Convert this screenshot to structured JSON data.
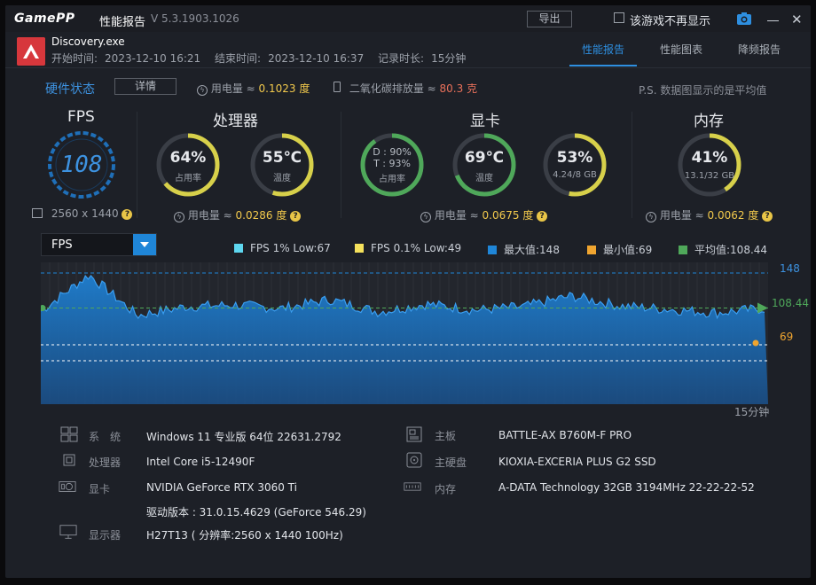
{
  "titlebar": {
    "logo": "GamePP",
    "title": "性能报告",
    "version": "V 5.3.1903.1026",
    "export_label": "导出",
    "dont_show_label": "该游戏不再显示"
  },
  "session": {
    "app_name": "Discovery.exe",
    "start_label": "开始时间:",
    "start_time": "2023-12-10 16:21",
    "end_label": "结束时间:",
    "end_time": "2023-12-10 16:37",
    "duration_label": "记录时长:",
    "duration": "15分钟"
  },
  "tabs": [
    {
      "label": "性能报告",
      "active": true
    },
    {
      "label": "性能图表",
      "active": false
    },
    {
      "label": "降频报告",
      "active": false
    }
  ],
  "summary": {
    "hw_status_label": "硬件状态",
    "detail_label": "详情",
    "power_label": "用电量 ≈",
    "power_value": "0.1023 度",
    "co2_label": "二氧化碳排放量 ≈",
    "co2_value": "80.3 克",
    "note": "P.S. 数据图显示的是平均值"
  },
  "fps": {
    "title": "FPS",
    "value": "108",
    "resolution": "2560 x 1440"
  },
  "cpu": {
    "title": "处理器",
    "usage_value": "64%",
    "usage_label": "占用率",
    "usage_fraction": 0.64,
    "temp_value": "55℃",
    "temp_label": "温度",
    "temp_fraction": 0.55,
    "power_label": "用电量 ≈",
    "power_value": "0.0286 度"
  },
  "gpu": {
    "title": "显卡",
    "d_line": "D : 90%",
    "t_line": "T : 93%",
    "usage_label": "占用率",
    "usage_fraction": 0.9,
    "temp_value": "69℃",
    "temp_label": "温度",
    "temp_fraction": 0.69,
    "vram_value": "53%",
    "vram_label": "4.24/8 GB",
    "vram_fraction": 0.53,
    "power_label": "用电量 ≈",
    "power_value": "0.0675 度"
  },
  "memory": {
    "title": "内存",
    "usage_value": "41%",
    "usage_label": "13.1/32 GB",
    "usage_fraction": 0.41,
    "power_label": "用电量 ≈",
    "power_value": "0.0062 度"
  },
  "chart_controls": {
    "selected_metric": "FPS"
  },
  "colors": {
    "accent": "#2e8fe0",
    "gauge_yellow": "#d7d04a",
    "gauge_green": "#4fa85a",
    "low1": "#5ed7f0",
    "low01": "#f5e15c",
    "max": "#1f86d8",
    "min": "#f0a530",
    "avg": "#4fa85a"
  },
  "chart_data": {
    "type": "area",
    "title": "",
    "xlabel": "15分钟",
    "ylabel": "",
    "legend": [
      {
        "name": "FPS 1% Low:67",
        "color": "#5ed7f0"
      },
      {
        "name": "FPS 0.1% Low:49",
        "color": "#f5e15c"
      },
      {
        "name": "最大值:148",
        "color": "#1f86d8"
      },
      {
        "name": "最小值:69",
        "color": "#f0a530"
      },
      {
        "name": "平均值:108.44",
        "color": "#4fa85a"
      }
    ],
    "markers": {
      "max": "148",
      "avg": "108.44",
      "min": "69"
    },
    "reference_lines": {
      "max": 148,
      "avg": 108.44,
      "min": 69,
      "low1": 67,
      "low01": 49
    },
    "ylim": [
      0,
      148
    ],
    "x": [
      0,
      1,
      2,
      3,
      4,
      5,
      6,
      7,
      8,
      9,
      10,
      11,
      12,
      13,
      14,
      15
    ],
    "series": [
      {
        "values": [
          105,
          146,
          100,
          110,
          112,
          108,
          118,
          104,
          113,
          106,
          110,
          122,
          111,
          107,
          103,
          108
        ]
      }
    ]
  },
  "specs": {
    "os_label": "系　统",
    "os_value": "Windows 11 专业版 64位 22631.2792",
    "cpu_label": "处理器",
    "cpu_value": "Intel Core i5-12490F",
    "gpu_label": "显卡",
    "gpu_value": "NVIDIA GeForce RTX 3060 Ti",
    "driver_value": "驱动版本 : 31.0.15.4629 (GeForce 546.29)",
    "display_label": "显示器",
    "display_value": "H27T13 ( 分辨率:2560 x 1440 100Hz)",
    "board_label": "主板",
    "board_value": "BATTLE-AX B760M-F PRO",
    "disk_label": "主硬盘",
    "disk_value": "KIOXIA-EXCERIA PLUS G2 SSD",
    "mem_label": "内存",
    "mem_value": "A-DATA Technology 32GB 3194MHz 22-22-22-52"
  }
}
